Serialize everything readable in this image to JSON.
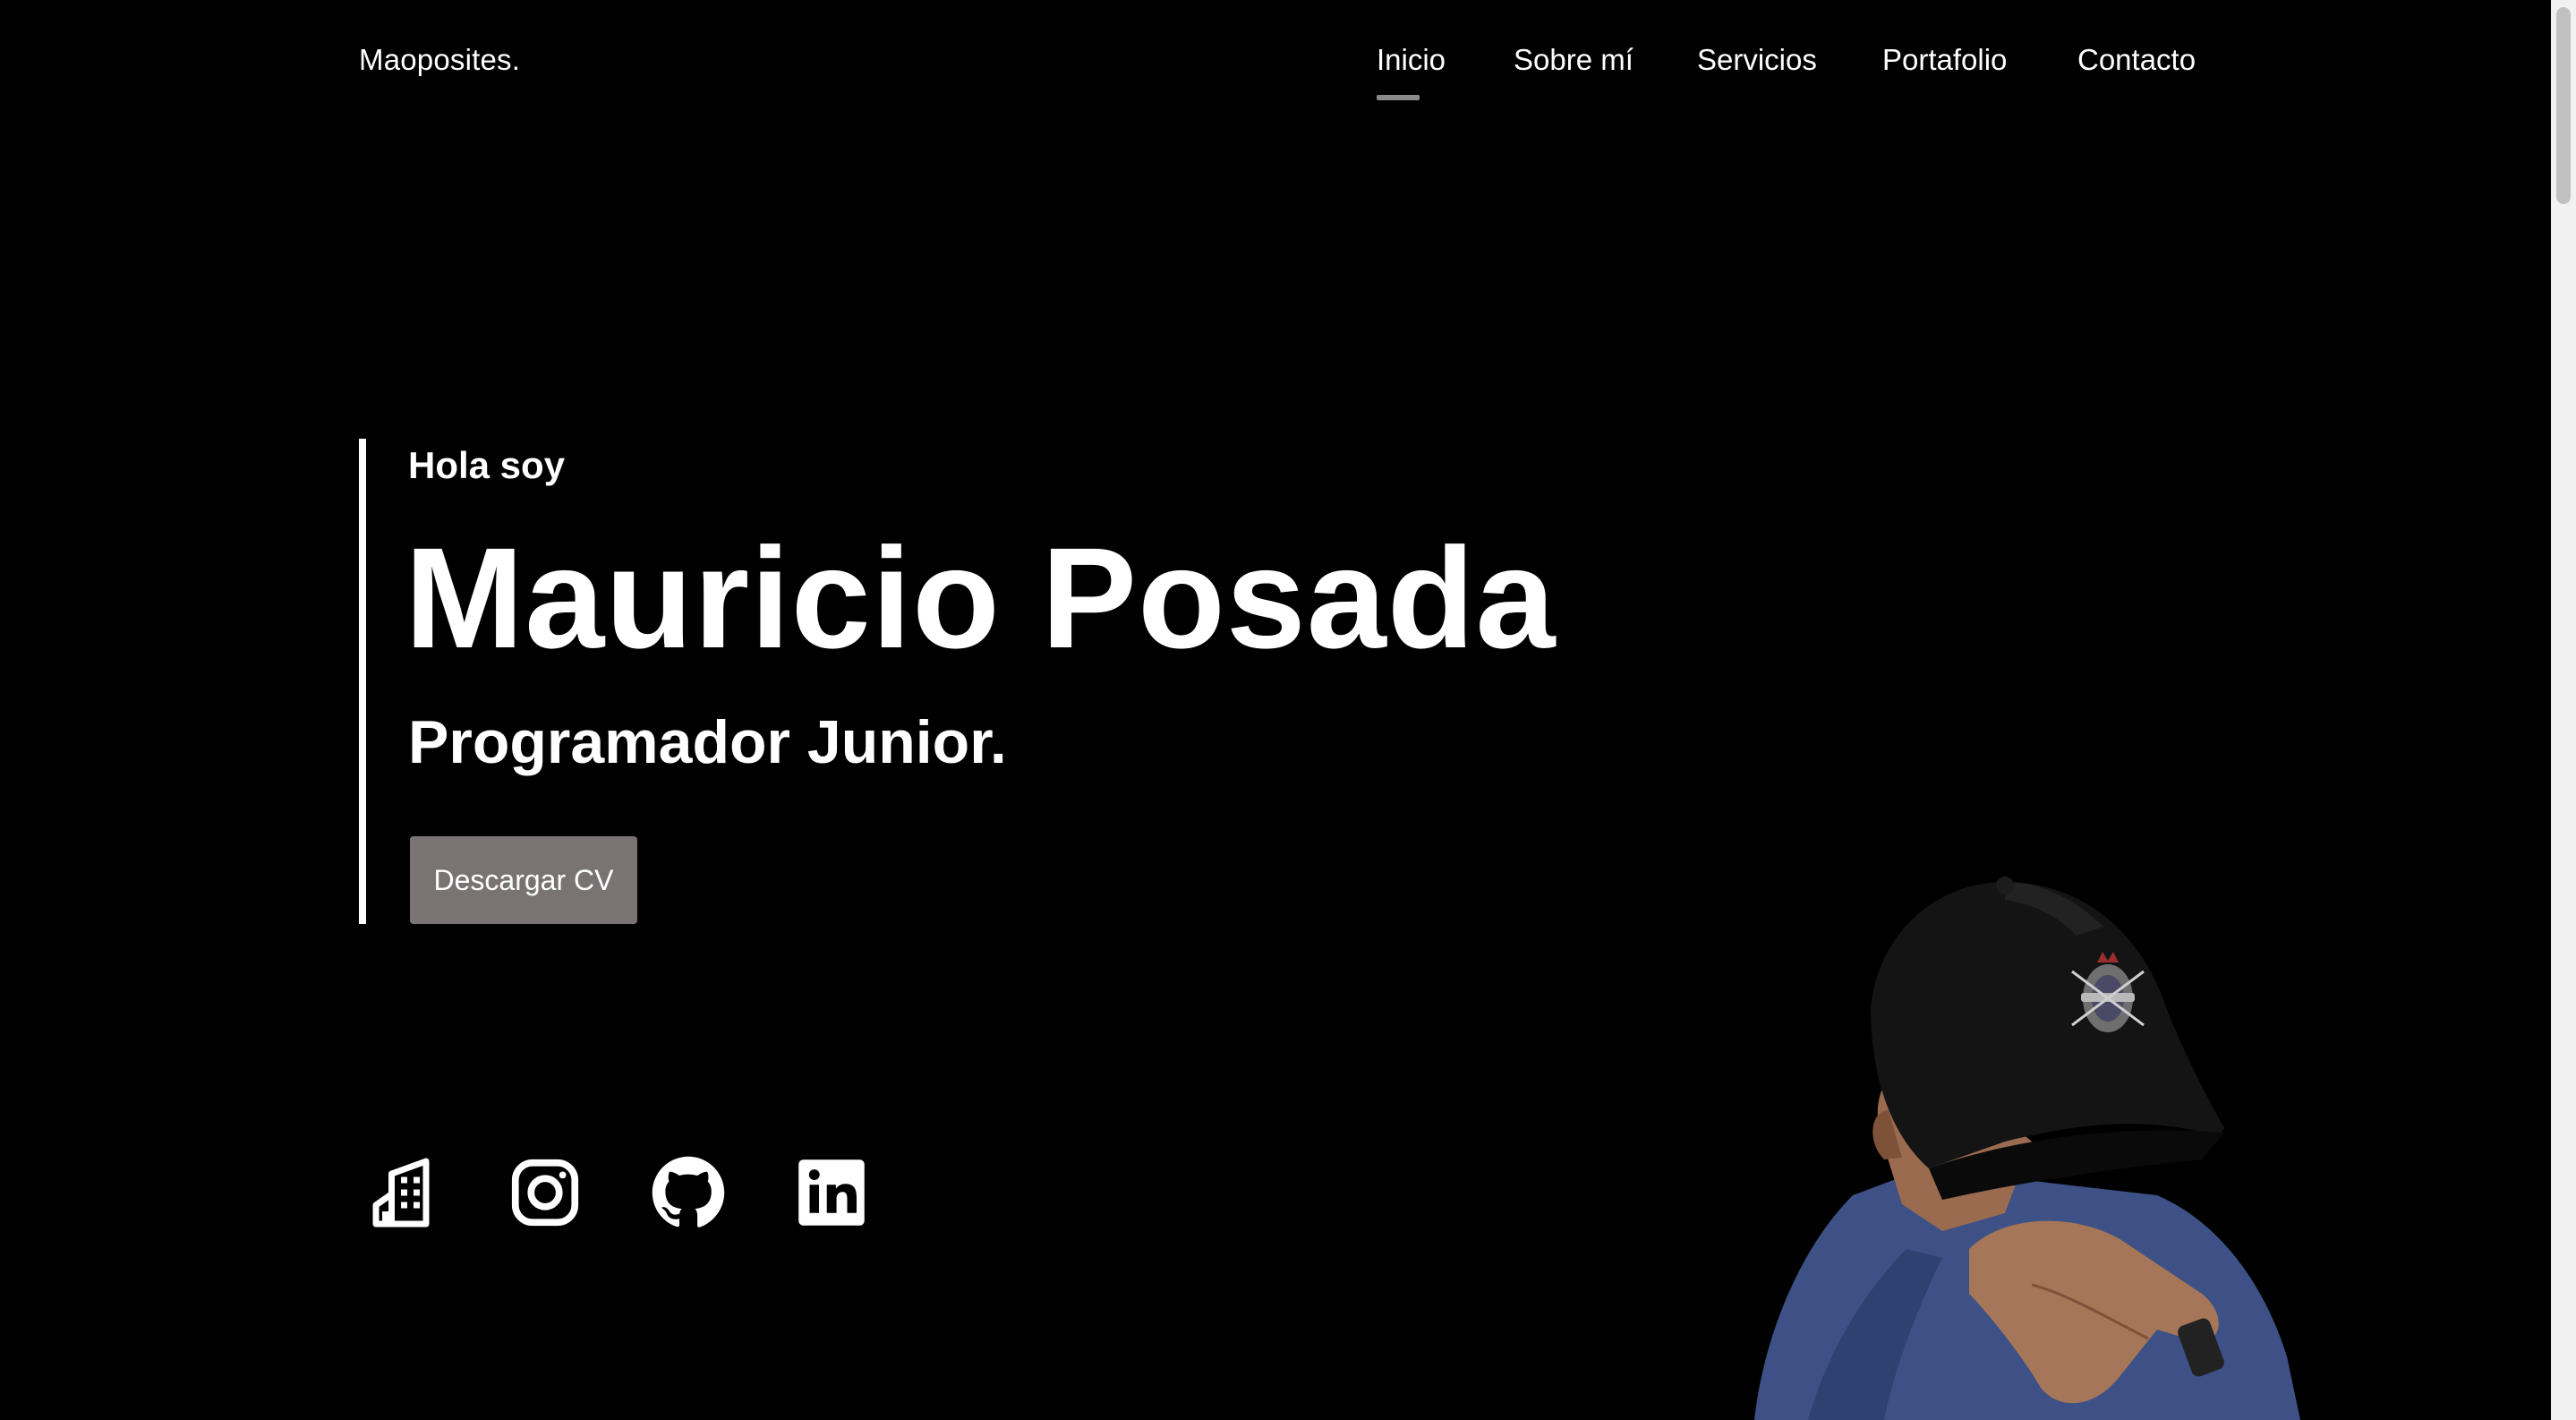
{
  "header": {
    "brand": "Maoposites.",
    "nav": [
      {
        "label": "Inicio",
        "active": true
      },
      {
        "label": "Sobre mí",
        "active": false
      },
      {
        "label": "Servicios",
        "active": false
      },
      {
        "label": "Portafolio",
        "active": false
      },
      {
        "label": "Contacto",
        "active": false
      }
    ]
  },
  "hero": {
    "greeting": "Hola soy",
    "name": "Mauricio Posada",
    "role": "Programador Junior.",
    "cv_button": "Descargar CV"
  },
  "social": [
    {
      "icon": "building-icon"
    },
    {
      "icon": "instagram-icon"
    },
    {
      "icon": "github-icon"
    },
    {
      "icon": "linkedin-icon"
    }
  ],
  "colors": {
    "background": "#000000",
    "text": "#ffffff",
    "button": "#7a7373",
    "nav_underline": "#8a8a8a"
  }
}
